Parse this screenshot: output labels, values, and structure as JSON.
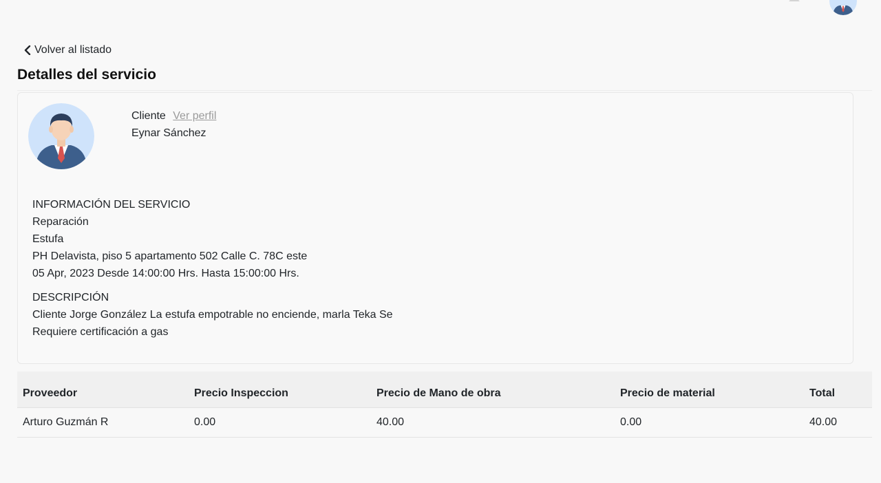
{
  "nav": {
    "back_label": "Volver al listado"
  },
  "page": {
    "title": "Detalles del servicio"
  },
  "client": {
    "label": "Cliente",
    "profile_link": "Ver perfil",
    "name": "Eynar Sánchez"
  },
  "service_info": {
    "heading": "INFORMACIÓN DEL SERVICIO",
    "type": "Reparación",
    "appliance": "Estufa",
    "address": "PH Delavista, piso 5 apartamento 502 Calle C. 78C este",
    "schedule": "05 Apr, 2023 Desde 14:00:00 Hrs. Hasta 15:00:00 Hrs."
  },
  "description": {
    "heading": "DESCRIPCIÓN",
    "line1": "Cliente Jorge González La estufa empotrable no enciende, marla Teka Se",
    "line2": "Requiere certificación a gas"
  },
  "providers_table": {
    "headers": [
      "Proveedor",
      "Precio Inspeccion",
      "Precio de Mano de obra",
      "Precio de material",
      "Total"
    ],
    "rows": [
      [
        "Arturo Guzmán R",
        "0.00",
        "40.00",
        "0.00",
        "40.00"
      ]
    ]
  },
  "icons": {
    "back": "chevron-left-icon",
    "notifications": "bell-icon",
    "avatar": "businessman-avatar"
  },
  "colors": {
    "background": "#f8f8f8",
    "link_muted": "#9a9a9a",
    "avatar_bg": "#cfe3fb",
    "suit": "#3d5f8c",
    "tie": "#d9534f"
  }
}
